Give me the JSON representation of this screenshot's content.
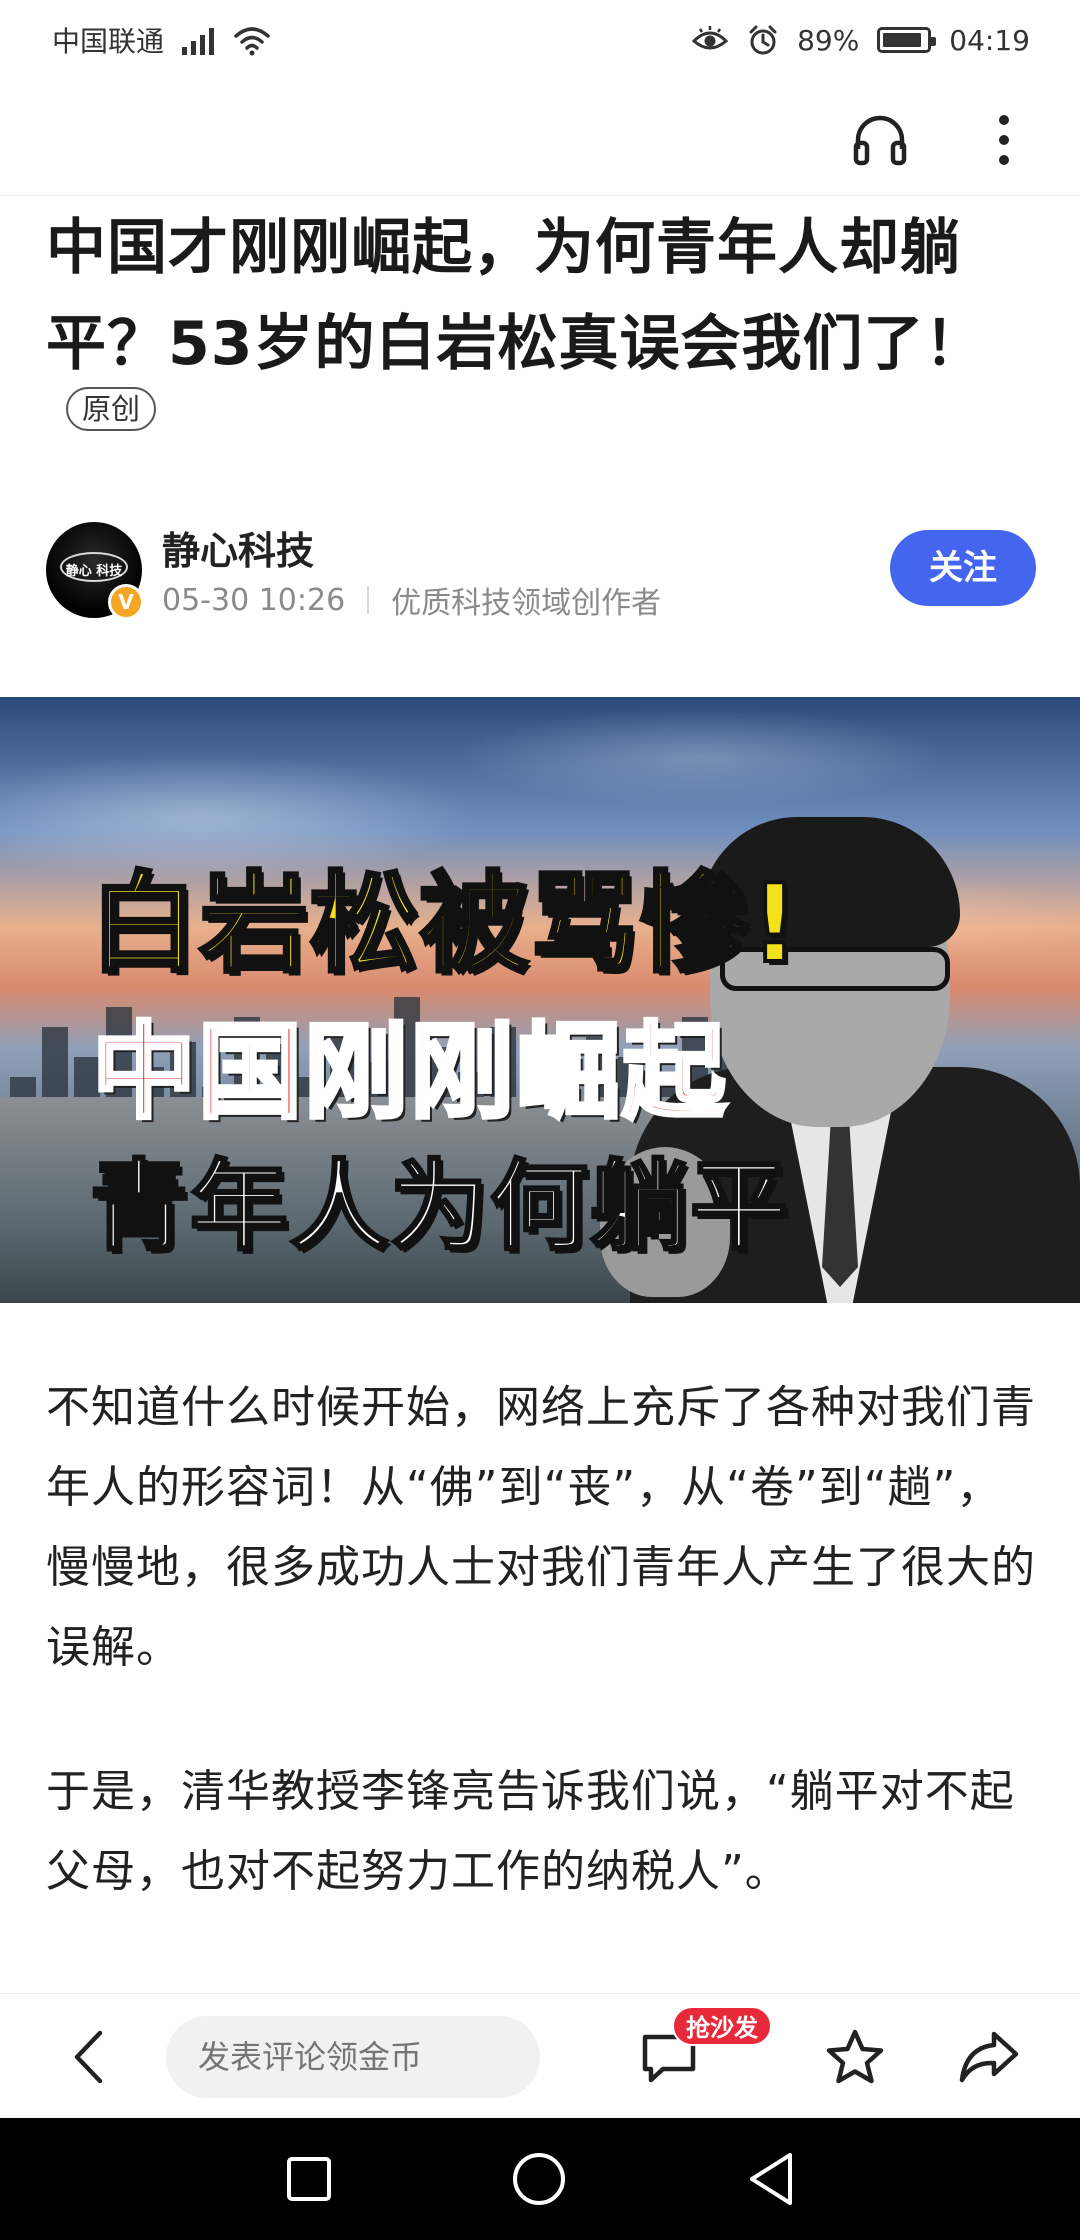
{
  "status_bar": {
    "carrier": "中国联通",
    "battery_percent": "89%",
    "time": "04:19",
    "battery_level": 0.89
  },
  "header": {
    "icons": [
      "headphones-icon",
      "more-vertical-icon"
    ]
  },
  "article": {
    "title": "中国才刚刚崛起，为何青年人却躺平？53岁的白岩松真误会我们了！",
    "original_badge": "原创",
    "author": {
      "name": "静心科技",
      "avatar_text": "静心 科技",
      "verified_mark": "V",
      "date": "05-30 10:26",
      "description": "优质科技领域创作者",
      "follow_label": "关注"
    },
    "hero_image": {
      "line1": "白岩松被骂惨!",
      "line2": "中国刚刚崛起",
      "line3": "青年人为何躺平"
    },
    "paragraphs": [
      "不知道什么时候开始，网络上充斥了各种对我们青年人的形容词！从“佛”到“丧”，从“卷”到“趟”，慢慢地，很多成功人士对我们青年人产生了很大的误解。",
      "于是，清华教授李锋亮告诉我们说，“躺平对不起父母，也对不起努力工作的纳税人”。"
    ]
  },
  "action_bar": {
    "comment_placeholder": "发表评论领金币",
    "sofa_badge": "抢沙发",
    "icons": [
      "back-chevron-icon",
      "comment-icon",
      "star-icon",
      "share-icon"
    ]
  },
  "navigation_bar": {
    "icons": [
      "recent-apps-icon",
      "home-icon",
      "back-triangle-icon"
    ]
  },
  "colors": {
    "follow_button": "#4466ee",
    "sofa_badge": "#e8293a",
    "hero_yellow": "#f5e11a",
    "hero_red": "#e41a1a"
  }
}
